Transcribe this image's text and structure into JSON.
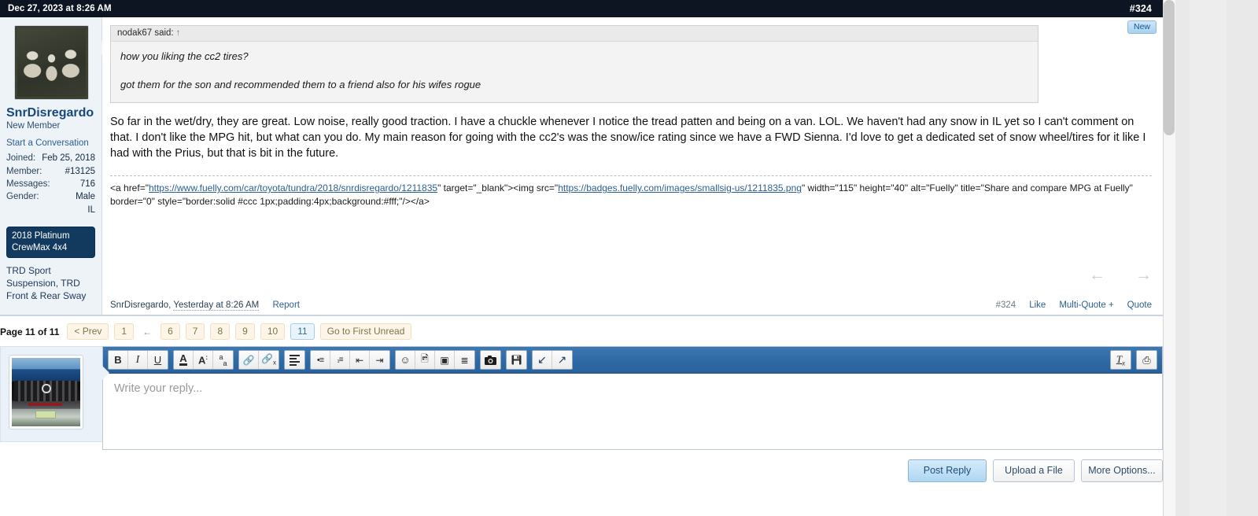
{
  "post": {
    "header": {
      "date": "Dec 27, 2023 at 8:26 AM",
      "post_number": "#324"
    },
    "new_badge": "New",
    "author": {
      "username": "SnrDisregardo",
      "title": "New Member",
      "conversation_link": "Start a Conversation",
      "stats": [
        {
          "key": "Joined:",
          "value": "Feb 25, 2018"
        },
        {
          "key": "Member:",
          "value": "#13125"
        },
        {
          "key": "Messages:",
          "value": "716"
        },
        {
          "key": "Gender:",
          "value": "Male"
        }
      ],
      "location": "IL",
      "vehicle_badge": "2018 Platinum CrewMax 4x4",
      "mods": "TRD Sport Suspension, TRD Front & Rear Sway"
    },
    "quote": {
      "attribution": "nodak67 said:",
      "jump_icon": "↑",
      "lines": [
        "how you liking the cc2 tires?",
        "got them for the son and recommended them to a friend also for his wifes rogue"
      ]
    },
    "body": "So far in the wet/dry, they are great. Low noise, really good traction. I have a chuckle whenever I notice the tread patten and being on a van. LOL. We haven't had any snow in IL yet so I can't comment on that. I don't like the MPG hit, but what can you do. My main reason for going with the cc2's was the snow/ice rating since we have a FWD Sienna. I'd love to get a dedicated set of snow wheel/tires for it like I had with the Prius, but that is bit in the future.",
    "signature": {
      "prefix": "<a href=\"",
      "link1": "https://www.fuelly.com/car/toyota/tundra/2018/snrdisregardo/1211835",
      "mid1": "\" target=\"_blank\"><img src=\"",
      "link2": "https://badges.fuelly.com/images/smallsig-us/1211835.png",
      "mid2": "\" width=\"115\" height=\"40\" alt=\"Fuelly\" title=\"Share and compare MPG at Fuelly\" border=\"0\" style=\"border:solid #ccc 1px;padding:4px;background:#fff;\"/></a>"
    },
    "footer": {
      "author_line": "SnrDisregardo,",
      "timestamp": "Yesterday at 8:26 AM",
      "report": "Report",
      "post_number": "#324",
      "like": "Like",
      "multi_quote": "Multi-Quote +",
      "quote": "Quote",
      "prev_arrow": "←",
      "next_arrow": "→"
    }
  },
  "pagination": {
    "label": "Page 11 of 11",
    "prev": "< Prev",
    "first_page": "1",
    "ellipsis": "←",
    "pages": [
      "6",
      "7",
      "8",
      "9",
      "10",
      "11"
    ],
    "current": "11",
    "goto_unread": "Go to First Unread"
  },
  "reply": {
    "placeholder": "Write your reply...",
    "toolbar": {
      "groups": [
        {
          "name": "text-style",
          "buttons": [
            {
              "name": "bold-icon",
              "glyph": "B"
            },
            {
              "name": "italic-icon",
              "glyph": "I"
            },
            {
              "name": "underline-icon",
              "glyph": "U"
            }
          ]
        },
        {
          "name": "font-style",
          "buttons": [
            {
              "name": "text-color-icon",
              "glyph": "A"
            },
            {
              "name": "font-size-icon",
              "glyph": "A·"
            },
            {
              "name": "font-family-icon",
              "glyph": "aₐ"
            }
          ]
        },
        {
          "name": "link",
          "buttons": [
            {
              "name": "insert-link-icon",
              "glyph": "⚭"
            },
            {
              "name": "remove-link-icon",
              "glyph": "⚮"
            }
          ]
        },
        {
          "name": "align",
          "buttons": [
            {
              "name": "align-icon",
              "glyph": "≡"
            }
          ]
        },
        {
          "name": "lists",
          "buttons": [
            {
              "name": "bullet-list-icon",
              "glyph": "•≡"
            },
            {
              "name": "numbered-list-icon",
              "glyph": "1≡"
            },
            {
              "name": "outdent-icon",
              "glyph": "⇤"
            },
            {
              "name": "indent-icon",
              "glyph": "⇥"
            }
          ]
        },
        {
          "name": "insert",
          "buttons": [
            {
              "name": "smilie-icon",
              "glyph": "☺"
            },
            {
              "name": "insert-image-icon",
              "glyph": "Ὓc"
            },
            {
              "name": "insert-media-icon",
              "glyph": "▣"
            },
            {
              "name": "insert-quote-icon",
              "glyph": "≣"
            }
          ]
        },
        {
          "name": "camera",
          "buttons": [
            {
              "name": "camera-icon",
              "glyph": "●"
            }
          ]
        },
        {
          "name": "drafts",
          "buttons": [
            {
              "name": "save-draft-icon",
              "glyph": "Ὃe"
            }
          ]
        },
        {
          "name": "history",
          "buttons": [
            {
              "name": "undo-icon",
              "glyph": "↶"
            },
            {
              "name": "redo-icon",
              "glyph": "↷"
            }
          ]
        }
      ],
      "right_buttons": [
        {
          "name": "remove-formatting-icon",
          "glyph": "Tx"
        },
        {
          "name": "toggle-bbcode-icon",
          "glyph": "⌕"
        }
      ]
    },
    "actions": {
      "post_reply": "Post Reply",
      "upload_file": "Upload a File",
      "more_options": "More Options..."
    }
  },
  "colors": {
    "header_bar": "#0e1522",
    "toolbar_blue": "#2f6aa6",
    "link_blue": "#2b5f93",
    "username_blue": "#16487d",
    "badge_navy": "#123a5e"
  }
}
